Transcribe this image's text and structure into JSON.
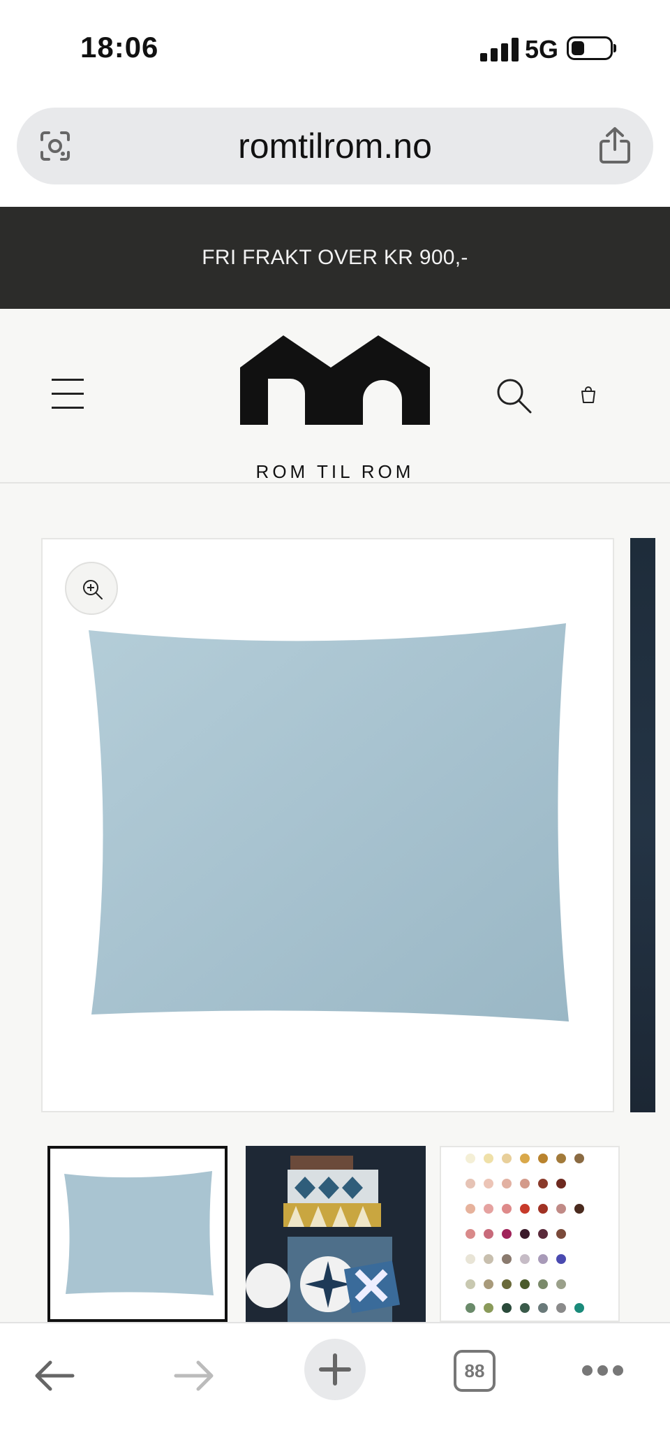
{
  "status_bar": {
    "time": "18:06",
    "network": "5G"
  },
  "browser": {
    "url": "romtilrom.no",
    "tabs_count": "88"
  },
  "announcement": {
    "text": "FRI FRAKT OVER KR 900,-"
  },
  "header": {
    "logo_text": "ROM TIL ROM"
  },
  "product": {
    "main_image_color": "#a9c4d1",
    "thumbnails": [
      "light-blue-cushion",
      "cushion-stack",
      "color-swatches"
    ],
    "selected_thumbnail": 0
  },
  "colors": {
    "announcement_bg": "#2c2c2a",
    "header_bg": "#f7f7f5",
    "pillow": "#a9c4d1"
  }
}
